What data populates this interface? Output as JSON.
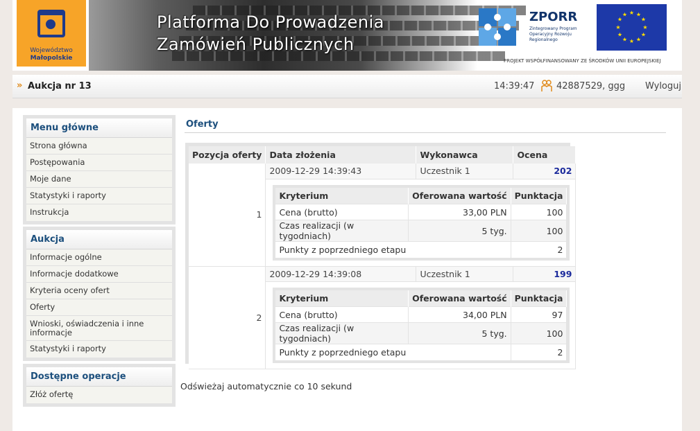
{
  "banner": {
    "logo_text_line1": "Województwo",
    "logo_text_line2": "Małopolskie",
    "title_line1": "Platforma Do Prowadzenia",
    "title_line2": "Zamówień Publicznych",
    "zporr_title": "ZPORR",
    "zporr_sub": "Zintegrowany Program Operacyjny Rozwoju Regionalnego",
    "eu_caption": "PROJEKT WSPÓŁFINANSOWANY ZE ŚRODKÓW UNII EUROPEJSKIEJ"
  },
  "topbar": {
    "chevron": "»",
    "auction": "Aukcja nr 13",
    "time": "14:39:47",
    "user": "42887529, ggg",
    "logout": "Wyloguj"
  },
  "sidebar": {
    "menu": {
      "title": "Menu główne",
      "items": [
        "Strona główna",
        "Postępowania",
        "Moje dane",
        "Statystyki i raporty",
        "Instrukcja"
      ]
    },
    "auction": {
      "title": "Aukcja",
      "items": [
        "Informacje ogólne",
        "Informacje dodatkowe",
        "Kryteria oceny ofert",
        "Oferty",
        "Wnioski, oświadczenia i inne informacje",
        "Statystyki i raporty"
      ]
    },
    "operations": {
      "title": "Dostępne operacje",
      "items": [
        "Złóż ofertę"
      ]
    }
  },
  "main": {
    "title": "Oferty",
    "headers": [
      "Pozycja oferty",
      "Data złożenia",
      "Wykonawca",
      "Ocena"
    ],
    "criteria_headers": [
      "Kryterium",
      "Oferowana wartość",
      "Punktacja"
    ],
    "offers": [
      {
        "position": "1",
        "date": "2009-12-29 14:39:43",
        "contractor": "Uczestnik 1",
        "score": "202",
        "criteria": [
          {
            "name": "Cena (brutto)",
            "value": "33,00 PLN",
            "points": "100"
          },
          {
            "name": "Czas realizacji (w tygodniach)",
            "value": "5 tyg.",
            "points": "100"
          },
          {
            "name": "Punkty z poprzedniego etapu",
            "value": "",
            "points": "2"
          }
        ]
      },
      {
        "position": "2",
        "date": "2009-12-29 14:39:08",
        "contractor": "Uczestnik 1",
        "score": "199",
        "criteria": [
          {
            "name": "Cena (brutto)",
            "value": "34,00 PLN",
            "points": "97"
          },
          {
            "name": "Czas realizacji (w tygodniach)",
            "value": "5 tyg.",
            "points": "100"
          },
          {
            "name": "Punkty z poprzedniego etapu",
            "value": "",
            "points": "2"
          }
        ]
      }
    ],
    "refresh_text": "Odświeżaj automatycznie co 10 sekund"
  }
}
